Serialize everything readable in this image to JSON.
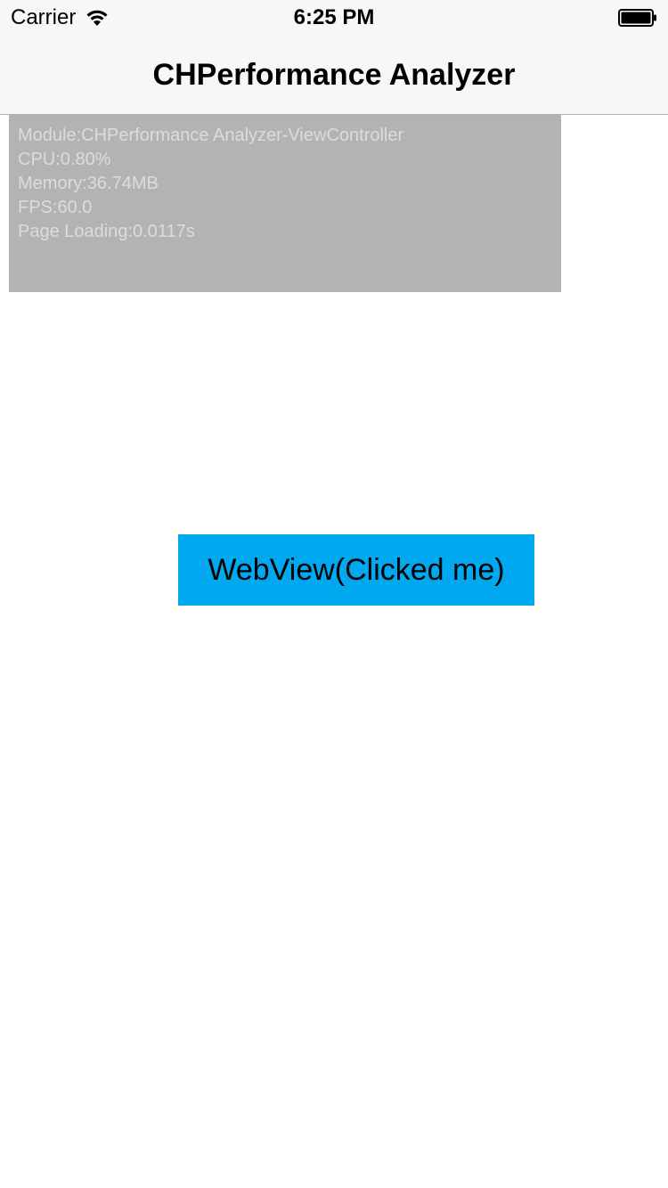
{
  "status_bar": {
    "carrier": "Carrier",
    "time": "6:25 PM",
    "wifi_icon": "wifi-icon",
    "battery_icon": "battery-icon"
  },
  "nav_bar": {
    "title": "CHPerformance Analyzer"
  },
  "performance_panel": {
    "module": "Module:CHPerformance Analyzer-ViewController",
    "cpu": "CPU:0.80%",
    "memory": "Memory:36.74MB",
    "fps": "FPS:60.0",
    "page_loading": "Page Loading:0.0117s"
  },
  "main": {
    "webview_button_label": "WebView(Clicked me)"
  },
  "colors": {
    "button_background": "#00a8f0",
    "panel_background": "#b3b3b3",
    "panel_text": "#dcdcdc",
    "bar_background": "#f7f7f7"
  }
}
